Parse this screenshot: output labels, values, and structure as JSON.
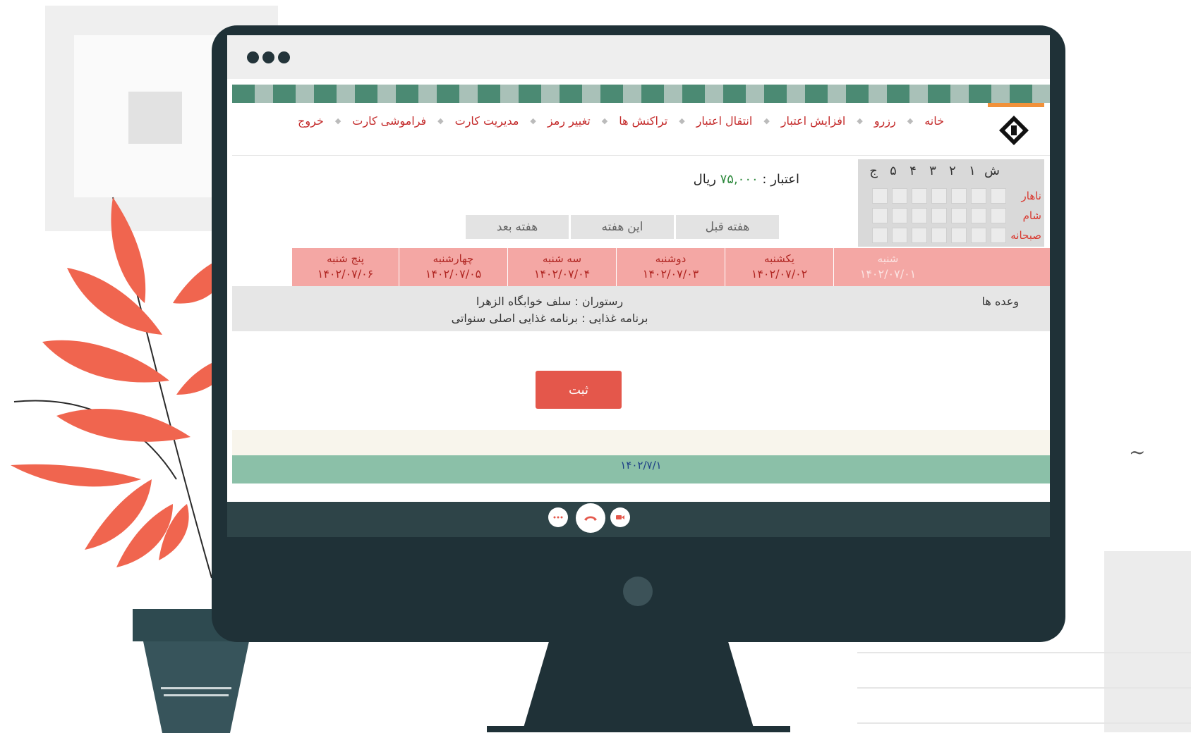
{
  "nav": {
    "items": [
      "خانه",
      "رزرو",
      "افزایش اعتبار",
      "انتقال اعتبار",
      "تراکنش ها",
      "تغییر رمز",
      "مدیریت کارت",
      "فراموشی کارت",
      "خروج"
    ]
  },
  "week_widget": {
    "days": [
      "ش",
      "۱",
      "۲",
      "۳",
      "۴",
      "۵",
      "ج"
    ],
    "meals": [
      "ناهار",
      "شام",
      "صبحانه"
    ]
  },
  "credit": {
    "label": "اعتبار :",
    "amount": "۷۵,۰۰۰",
    "currency": "ریال"
  },
  "week_buttons": {
    "prev": "هفته قبل",
    "current": "این هفته",
    "next": "هفته بعد"
  },
  "days": [
    {
      "name": "شنبه",
      "date": "۱۴۰۲/۰۷/۰۱"
    },
    {
      "name": "یکشنبه",
      "date": "۱۴۰۲/۰۷/۰۲"
    },
    {
      "name": "دوشنبه",
      "date": "۱۴۰۲/۰۷/۰۳"
    },
    {
      "name": "سه شنبه",
      "date": "۱۴۰۲/۰۷/۰۴"
    },
    {
      "name": "چهارشنبه",
      "date": "۱۴۰۲/۰۷/۰۵"
    },
    {
      "name": "پنج شنبه",
      "date": "۱۴۰۲/۰۷/۰۶"
    }
  ],
  "meals_row": {
    "label": "وعده ها",
    "restaurant": "رستوران : سلف خوابگاه الزهرا",
    "program": "برنامه غذایی : برنامه غذایی اصلی سنواتی"
  },
  "submit_label": "ثبت",
  "footer_date": "۱۴۰۲/۷/۱",
  "colors": {
    "accent": "#e4574b",
    "nav_link": "#c42b2b",
    "day_header": "#f4a7a4",
    "credit_amount": "#2f8a3e",
    "monitor": "#1f3137",
    "footer_green": "#8bc0a8"
  },
  "icons": {
    "call_more": "more-icon",
    "call_end": "phone-hangup-icon",
    "call_video": "video-icon",
    "logo": "university-logo"
  }
}
